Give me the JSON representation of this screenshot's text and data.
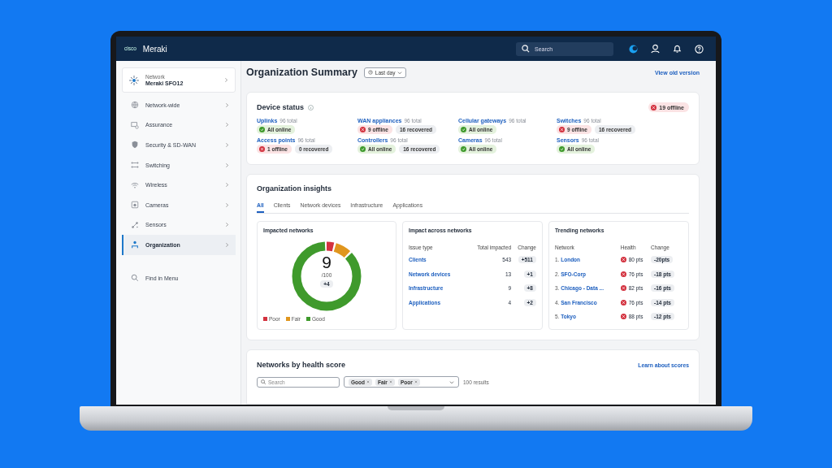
{
  "header": {
    "brand_mark": "cisco",
    "product": "Meraki",
    "search_placeholder": "Search"
  },
  "sidebar": {
    "network_label": "Network",
    "network_name": "Meraki SFO12",
    "items": [
      {
        "label": "Network-wide",
        "selected": false
      },
      {
        "label": "Assurance",
        "selected": false
      },
      {
        "label": "Security & SD-WAN",
        "selected": false
      },
      {
        "label": "Switching",
        "selected": false
      },
      {
        "label": "Wireless",
        "selected": false
      },
      {
        "label": "Cameras",
        "selected": false
      },
      {
        "label": "Sensors",
        "selected": false
      },
      {
        "label": "Organization",
        "selected": true
      }
    ],
    "find_in_menu": "Find in Menu"
  },
  "page": {
    "title": "Organization Summary",
    "time_range": "Last day",
    "view_old_version": "View old version"
  },
  "device_status": {
    "title": "Device status",
    "offline_badge": "19 offline",
    "groups": [
      {
        "name": "Uplinks",
        "total": "96 total",
        "chips": [
          {
            "kind": "ok",
            "label": "All online"
          }
        ]
      },
      {
        "name": "WAN appliances",
        "total": "96 total",
        "chips": [
          {
            "kind": "error",
            "label": "9 offline"
          },
          {
            "kind": "neutral",
            "label": "16 recovered"
          }
        ]
      },
      {
        "name": "Cellular gateways",
        "total": "96 total",
        "chips": [
          {
            "kind": "ok",
            "label": "All online"
          }
        ]
      },
      {
        "name": "Switches",
        "total": "96 total",
        "chips": [
          {
            "kind": "error",
            "label": "9 offline"
          },
          {
            "kind": "neutral",
            "label": "16 recovered"
          }
        ]
      },
      {
        "name": "Access points",
        "total": "96 total",
        "chips": [
          {
            "kind": "error",
            "label": "1 offline"
          },
          {
            "kind": "neutral",
            "label": "0 recovered"
          }
        ]
      },
      {
        "name": "Controllers",
        "total": "96 total",
        "chips": [
          {
            "kind": "ok",
            "label": "All online"
          },
          {
            "kind": "neutral",
            "label": "16 recovered"
          }
        ]
      },
      {
        "name": "Cameras",
        "total": "96 total",
        "chips": [
          {
            "kind": "ok",
            "label": "All online"
          }
        ]
      },
      {
        "name": "Sensors",
        "total": "96 total",
        "chips": [
          {
            "kind": "ok",
            "label": "All online"
          }
        ]
      }
    ]
  },
  "insights": {
    "title": "Organization insights",
    "tabs": [
      {
        "label": "All",
        "selected": true
      },
      {
        "label": "Clients",
        "selected": false
      },
      {
        "label": "Network devices",
        "selected": false
      },
      {
        "label": "Infrastructure",
        "selected": false
      },
      {
        "label": "Applications",
        "selected": false
      }
    ],
    "impacted_networks": {
      "title": "Impacted networks",
      "value": "9",
      "out_of": "/100",
      "change": "+4",
      "legend": [
        {
          "label": "Poor",
          "color": "#d3323f"
        },
        {
          "label": "Fair",
          "color": "#e0961e"
        },
        {
          "label": "Good",
          "color": "#3f9a2c"
        }
      ]
    },
    "impact_across_networks": {
      "title": "Impact across networks",
      "columns": [
        "Issue type",
        "Total impacted",
        "Change"
      ],
      "rows": [
        {
          "issue_type": "Clients",
          "total_impacted": "543",
          "change": "+511"
        },
        {
          "issue_type": "Network devices",
          "total_impacted": "13",
          "change": "+1"
        },
        {
          "issue_type": "Infrastructure",
          "total_impacted": "9",
          "change": "+8"
        },
        {
          "issue_type": "Applications",
          "total_impacted": "4",
          "change": "+2"
        }
      ]
    },
    "trending_networks": {
      "title": "Trending networks",
      "columns": [
        "Network",
        "Health",
        "Change"
      ],
      "rows": [
        {
          "rank": "1.",
          "network": "London",
          "health": "80 pts",
          "change": "-20pts"
        },
        {
          "rank": "2.",
          "network": "SFO-Corp",
          "health": "76 pts",
          "change": "-18 pts"
        },
        {
          "rank": "3.",
          "network": "Chicago - Data ...",
          "health": "82 pts",
          "change": "-16 pts"
        },
        {
          "rank": "4.",
          "network": "San Francisco",
          "health": "76 pts",
          "change": "-14 pts"
        },
        {
          "rank": "5.",
          "network": "Tokyo",
          "health": "88 pts",
          "change": "-12 pts"
        }
      ]
    }
  },
  "networks_by_health_score": {
    "title": "Networks by health score",
    "learn_link": "Learn about scores",
    "search_placeholder": "Search",
    "filters": [
      "Good",
      "Fair",
      "Poor"
    ],
    "results": "100 results"
  }
}
